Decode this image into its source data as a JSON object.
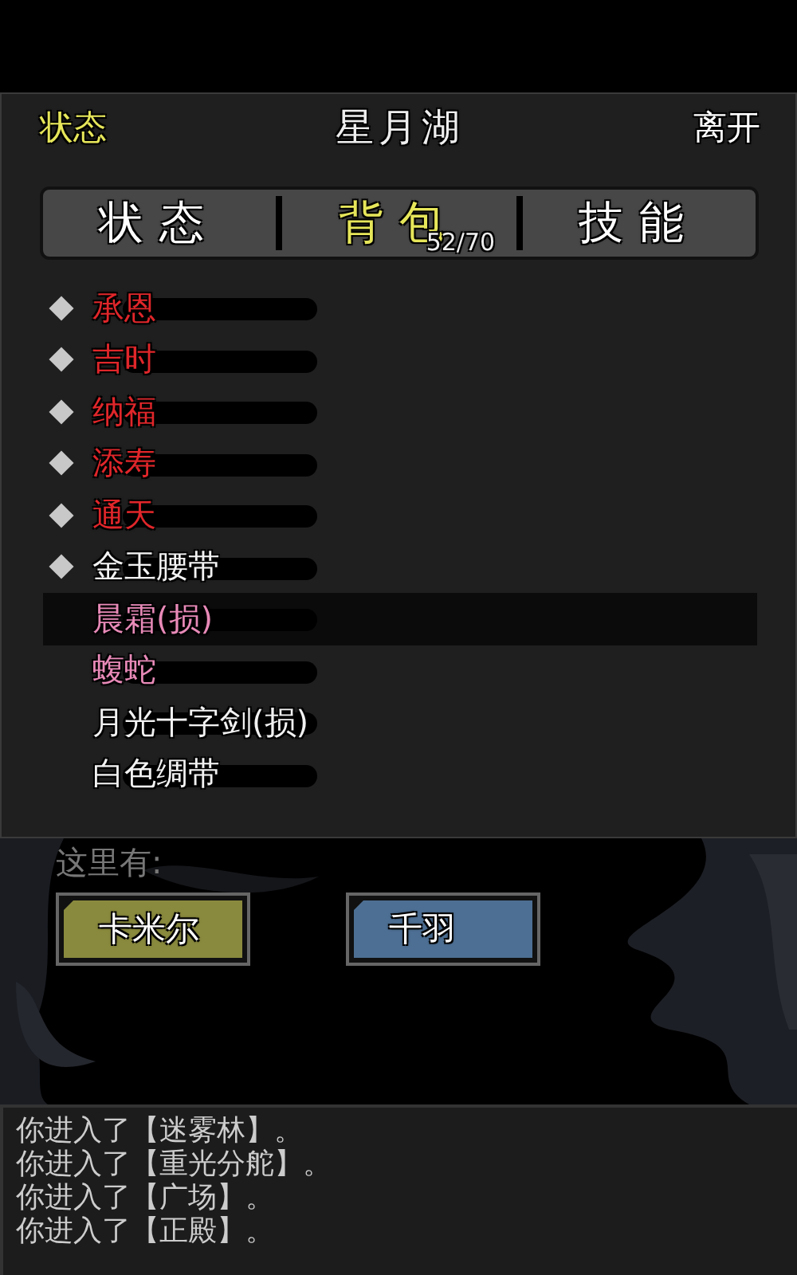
{
  "header": {
    "left": "状态",
    "title": "星月湖",
    "right": "离开"
  },
  "tabs": [
    {
      "label": "状态",
      "selected": false
    },
    {
      "label": "背包",
      "selected": true,
      "count": "52/70"
    },
    {
      "label": "技能",
      "selected": false
    }
  ],
  "items": [
    {
      "name": "承恩",
      "equipped": true,
      "color": "#e0262a",
      "selected": false
    },
    {
      "name": "吉时",
      "equipped": true,
      "color": "#e0262a",
      "selected": false
    },
    {
      "name": "纳福",
      "equipped": true,
      "color": "#e0262a",
      "selected": false
    },
    {
      "name": "添寿",
      "equipped": true,
      "color": "#e0262a",
      "selected": false
    },
    {
      "name": "通天",
      "equipped": true,
      "color": "#e0262a",
      "selected": false
    },
    {
      "name": "金玉腰带",
      "equipped": true,
      "color": "#f2f2f2",
      "selected": false
    },
    {
      "name": "晨霜(损)",
      "equipped": false,
      "color": "#e88ab8",
      "selected": true
    },
    {
      "name": "蝮蛇",
      "equipped": false,
      "color": "#e88ab8",
      "selected": false
    },
    {
      "name": "月光十字剑(损)",
      "equipped": false,
      "color": "#f2f2f2",
      "selected": false
    },
    {
      "name": "白色绸带",
      "equipped": false,
      "color": "#f2f2f2",
      "selected": false
    }
  ],
  "here": {
    "label": "这里有:",
    "npcs": [
      {
        "name": "卡米尔",
        "color": "#8a8a3e"
      },
      {
        "name": "千羽",
        "color": "#4d6f93"
      }
    ]
  },
  "log": [
    "你进入了【迷雾林】。",
    "你进入了【重光分舵】。",
    "你进入了【广场】。",
    "你进入了【正殿】。"
  ]
}
